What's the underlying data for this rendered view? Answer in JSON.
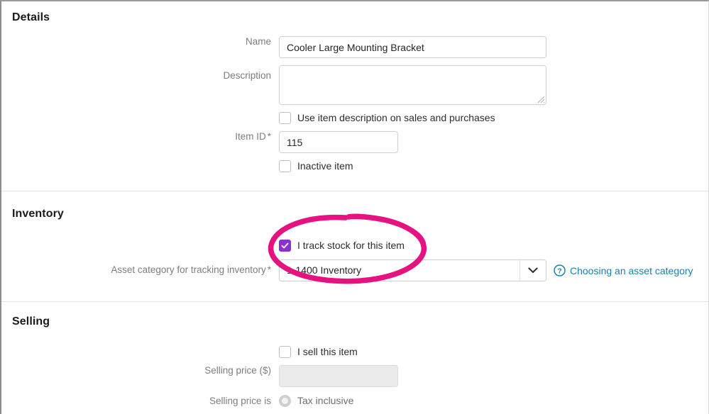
{
  "sections": {
    "details": {
      "title": "Details",
      "fields": {
        "name_label": "Name",
        "name_value": "Cooler Large Mounting Bracket",
        "description_label": "Description",
        "description_value": "",
        "use_item_description_label": "Use item description on sales and purchases",
        "item_id_label": "Item ID",
        "item_id_required_marker": "*",
        "item_id_value": "115",
        "inactive_item_label": "Inactive item"
      }
    },
    "inventory": {
      "title": "Inventory",
      "fields": {
        "track_stock_label": "I track stock for this item",
        "asset_category_label": "Asset category for tracking inventory",
        "asset_category_required_marker": "*",
        "asset_category_value": "1-1400  Inventory",
        "help_link_label": "Choosing an asset category"
      }
    },
    "selling": {
      "title": "Selling",
      "fields": {
        "sell_item_label": "I sell this item",
        "selling_price_label": "Selling price ($)",
        "selling_price_value": "",
        "selling_price_is_label": "Selling price is",
        "tax_inclusive_label": "Tax inclusive"
      }
    }
  },
  "icons": {
    "checkmark": "check-icon",
    "chevron_down": "chevron-down-icon",
    "help": "question-mark-circle-icon",
    "resize_grip": "resize-grip-icon",
    "annotation": "pink-circle-annotation"
  },
  "colors": {
    "checkbox_checked": "#8b2fd0",
    "link": "#1b7fa8",
    "annotation_pink": "#e5127f",
    "label_gray": "#7d7d7d",
    "border_gray": "#ccd0d4",
    "divider": "#e3e3e3",
    "disabled_field": "#ebebeb"
  }
}
